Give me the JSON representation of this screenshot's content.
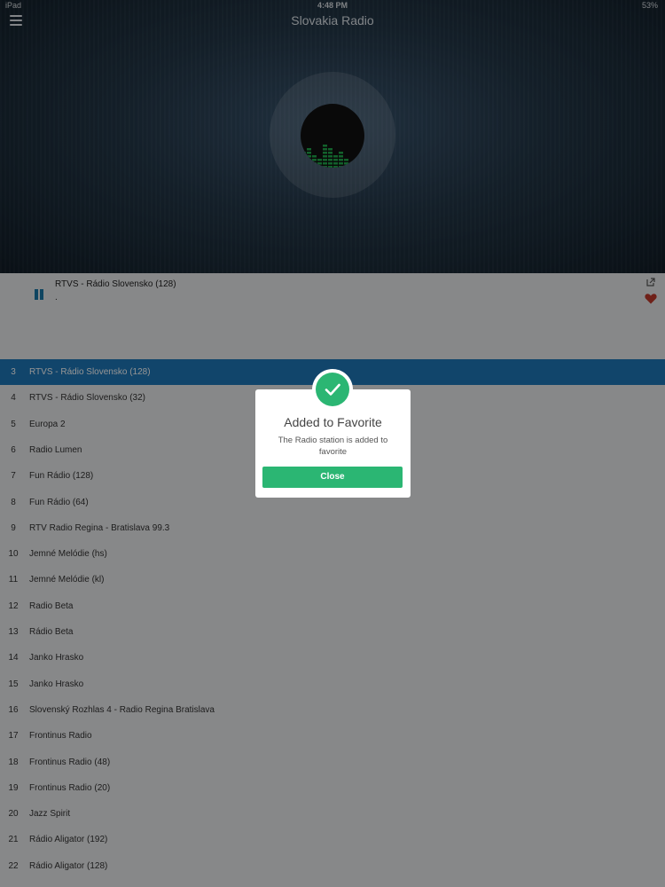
{
  "status_bar": {
    "carrier": "iPad",
    "time": "4:48 PM",
    "battery": "53%"
  },
  "header": {
    "title": "Slovakia Radio"
  },
  "now_playing": {
    "title": "RTVS - Rádio Slovensko (128)",
    "subtitle": "."
  },
  "stations": [
    {
      "num": "3",
      "name": "RTVS - Rádio Slovensko (128)",
      "active": true
    },
    {
      "num": "4",
      "name": "RTVS - Rádio Slovensko (32)"
    },
    {
      "num": "5",
      "name": "Europa 2"
    },
    {
      "num": "6",
      "name": "Radio Lumen"
    },
    {
      "num": "7",
      "name": "Fun Rádio (128)"
    },
    {
      "num": "8",
      "name": "Fun Rádio (64)"
    },
    {
      "num": "9",
      "name": "RTV Radio Regina - Bratislava 99.3"
    },
    {
      "num": "10",
      "name": "Jemné Melódie (hs)"
    },
    {
      "num": "11",
      "name": "Jemné Melódie (kl)"
    },
    {
      "num": "12",
      "name": "Radio Beta"
    },
    {
      "num": "13",
      "name": "Rádio Beta"
    },
    {
      "num": "14",
      "name": "Janko Hrasko"
    },
    {
      "num": "15",
      "name": "Janko Hrasko"
    },
    {
      "num": "16",
      "name": "Slovenský Rozhlas 4 - Radio Regina Bratislava"
    },
    {
      "num": "17",
      "name": "Frontinus Radio"
    },
    {
      "num": "18",
      "name": "Frontinus Radio (48)"
    },
    {
      "num": "19",
      "name": "Frontinus Radio (20)"
    },
    {
      "num": "20",
      "name": "Jazz Spirit"
    },
    {
      "num": "21",
      "name": "Rádio Aligator (192)"
    },
    {
      "num": "22",
      "name": "Rádio Aligator (128)"
    }
  ],
  "dialog": {
    "title": "Added to Favorite",
    "message": "The Radio station is added to favorite",
    "close_label": "Close"
  },
  "colors": {
    "accent_blue": "#1e77b8",
    "success_green": "#2bb673",
    "favorite_red": "#c0392b"
  },
  "icons": {
    "menu": "hamburger-menu-icon",
    "pause": "pause-icon",
    "share": "share-icon",
    "favorite": "heart-icon",
    "check": "checkmark-icon"
  }
}
